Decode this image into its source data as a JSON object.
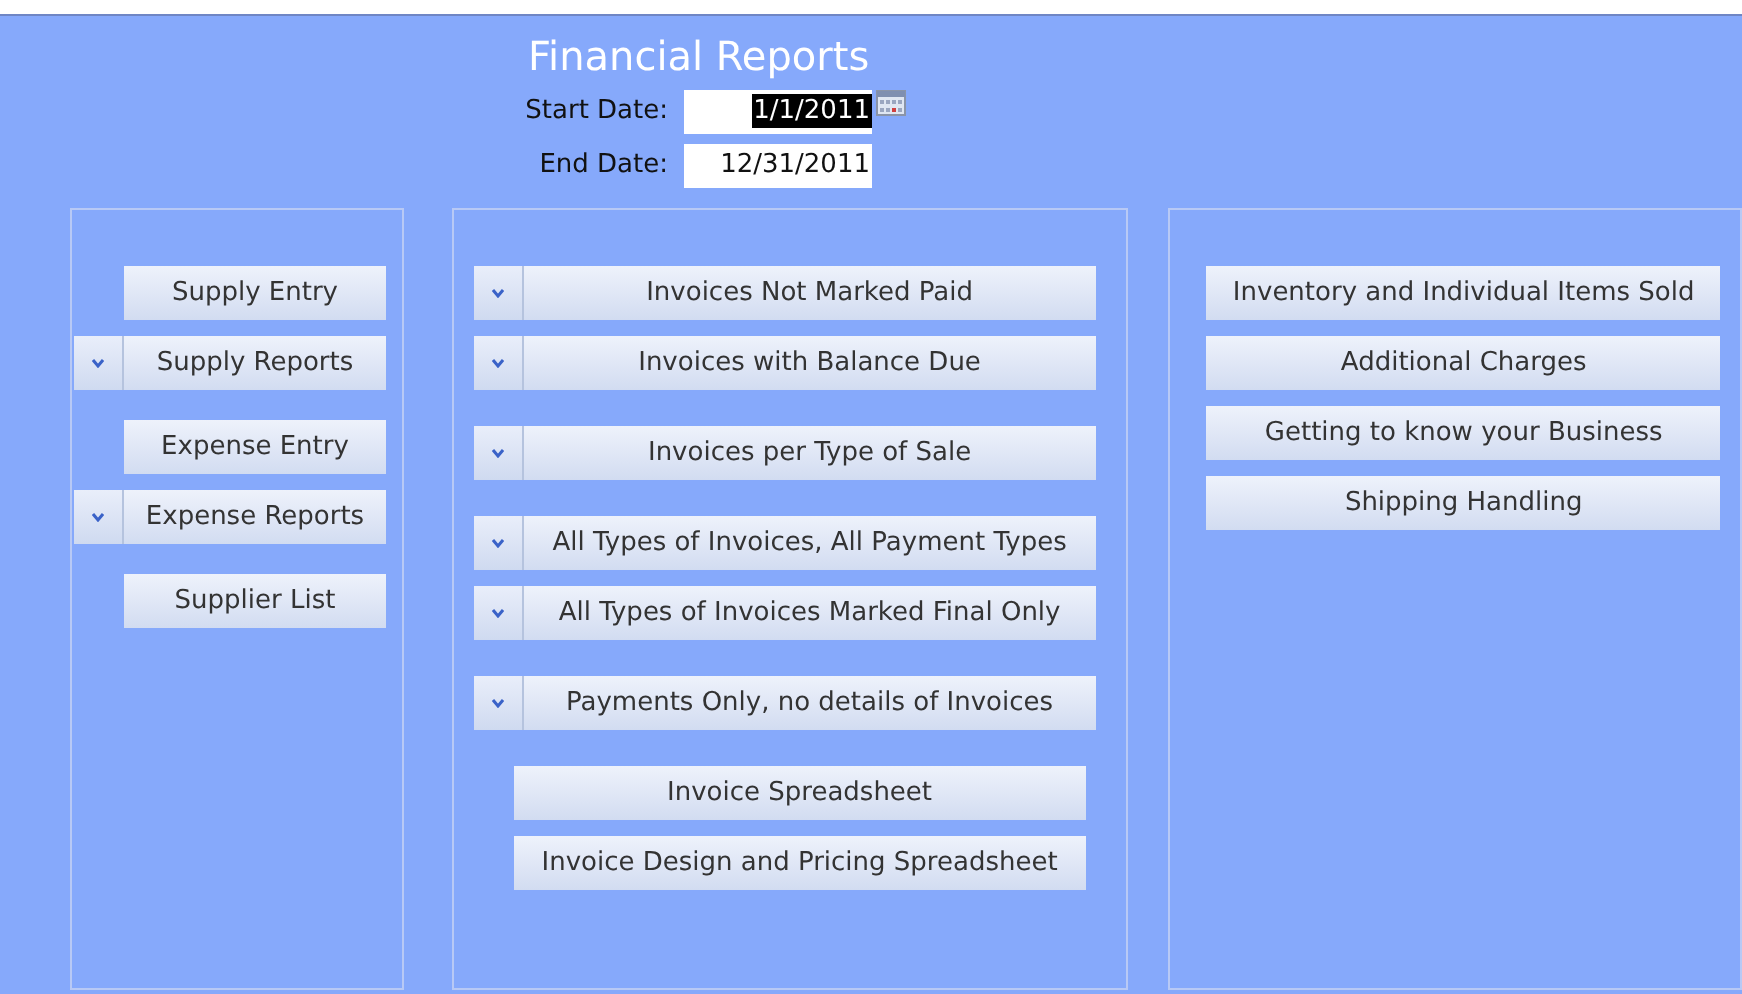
{
  "title": "Financial Reports",
  "dates": [
    {
      "label": "Start Date:",
      "value": "1/1/2011",
      "selected": true,
      "calendar": true
    },
    {
      "label": "End Date:",
      "value": "12/31/2011",
      "selected": false,
      "calendar": false
    }
  ],
  "panels": [
    {
      "groups": [
        [
          {
            "label": "Supply Entry",
            "dropdown": false
          },
          {
            "label": "Supply Reports",
            "dropdown": true
          }
        ],
        [
          {
            "label": "Expense Entry",
            "dropdown": false
          },
          {
            "label": "Expense Reports",
            "dropdown": true
          }
        ],
        [
          {
            "label": "Supplier List",
            "dropdown": false
          }
        ]
      ]
    },
    {
      "groups": [
        [
          {
            "label": "Invoices Not Marked Paid",
            "dropdown": true
          },
          {
            "label": "Invoices with Balance Due",
            "dropdown": true
          }
        ],
        [
          {
            "label": "Invoices per Type of Sale",
            "dropdown": true
          }
        ],
        [
          {
            "label": "All Types of Invoices, All Payment Types",
            "dropdown": true
          },
          {
            "label": "All Types of Invoices Marked Final Only",
            "dropdown": true
          }
        ],
        [
          {
            "label": "Payments Only, no details of Invoices",
            "dropdown": true
          }
        ],
        [
          {
            "label": "Invoice Spreadsheet",
            "dropdown": false
          },
          {
            "label": "Invoice Design and Pricing Spreadsheet",
            "dropdown": false
          }
        ]
      ]
    },
    {
      "groups": [
        [
          {
            "label": "Inventory and Individual Items Sold",
            "dropdown": false
          },
          {
            "label": "Additional Charges",
            "dropdown": false
          },
          {
            "label": "Getting to know your Business",
            "dropdown": false
          },
          {
            "label": "Shipping Handling",
            "dropdown": false
          }
        ]
      ]
    }
  ]
}
